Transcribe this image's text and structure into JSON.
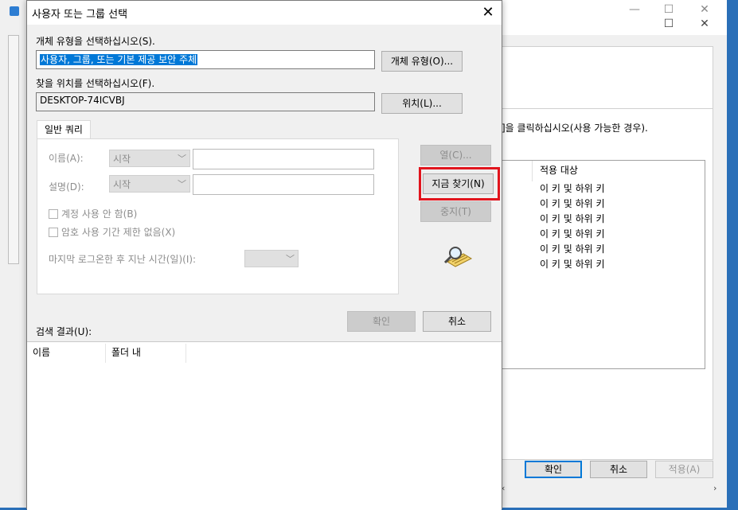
{
  "background_window": {
    "hint_text": "]을 클릭하십시오(사용 가능한 경우).",
    "perm_column_header": "적용 대상",
    "perm_rows": [
      "이 키 및 하위 키",
      "이 키 및 하위 키",
      "이 키 및 하위 키",
      "이 키 및 하위 키",
      "이 키 및 하위 키",
      "이 키 및 하위 키"
    ],
    "ok_label": "확인",
    "cancel_label": "취소",
    "apply_label": "적용(A)"
  },
  "dialog": {
    "title": "사용자 또는 그룹 선택",
    "object_type_label": "개체 유형을 선택하십시오(S).",
    "object_type_value": "사용자, 그룹, 또는 기본 제공 보안 주체",
    "object_type_button": "개체 유형(O)...",
    "location_label": "찾을 위치를 선택하십시오(F).",
    "location_value": "DESKTOP-74ICVBJ",
    "location_button": "위치(L)...",
    "query_tab": "일반 쿼리",
    "name_label": "이름(A):",
    "name_combo": "시작",
    "description_label": "설명(D):",
    "description_combo": "시작",
    "disabled_accounts_label": "계정 사용 안 함(B)",
    "nonexpiring_password_label": "암호 사용 기간 제한 없음(X)",
    "days_since_logon_label": "마지막 로그온한 후 지난 시간(일)(I):",
    "columns_button": "열(C)...",
    "find_now_button": "지금 찾기(N)",
    "stop_button": "중지(T)",
    "ok_button": "확인",
    "cancel_button": "취소",
    "results_label": "검색 결과(U):",
    "results_columns": [
      "이름",
      "폴더 내"
    ]
  },
  "colors": {
    "highlight_box": "#e1141d",
    "selection": "#0078d7",
    "desktop": "#2a6fb8"
  }
}
